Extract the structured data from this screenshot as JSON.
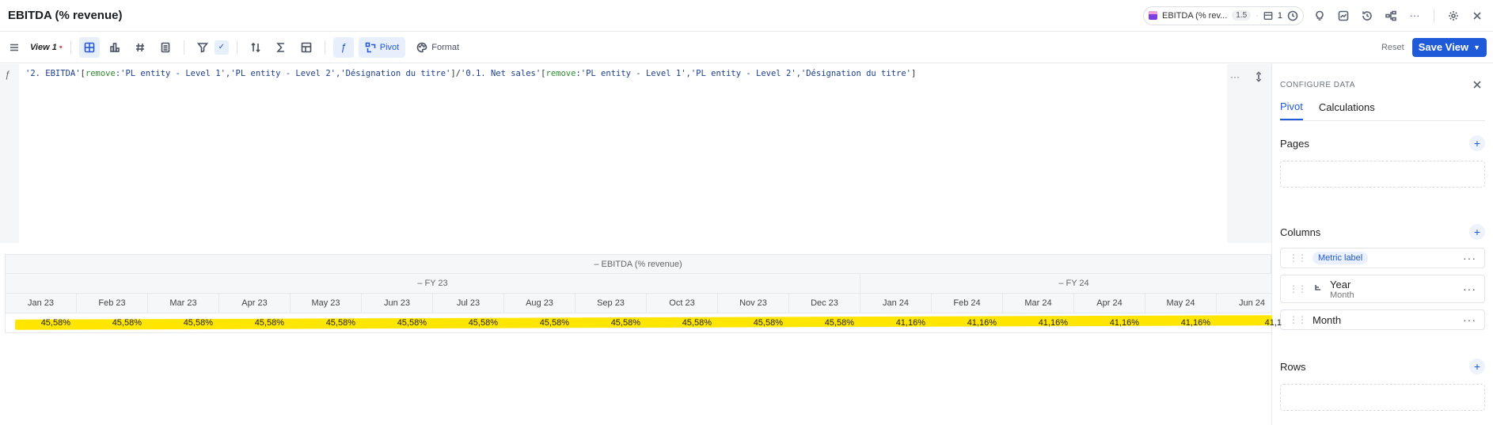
{
  "title": "EBITDA (% revenue)",
  "header_chip": {
    "label": "EBITDA (% rev...",
    "version": "1.5",
    "count": "1"
  },
  "toolbar": {
    "view_name": "View 1",
    "pivot_label": "Pivot",
    "format_label": "Format",
    "reset_label": "Reset",
    "save_label": "Save View"
  },
  "formula": {
    "parts": [
      {
        "t": "'2. EBITDA'",
        "c": "ref"
      },
      {
        "t": "[",
        "c": "op"
      },
      {
        "t": "remove",
        "c": "kw"
      },
      {
        "t": ":'PL entity - Level 1','PL entity - Level 2','Désignation du titre'",
        "c": "ref"
      },
      {
        "t": "]/",
        "c": "op"
      },
      {
        "t": "'0.1. Net sales'",
        "c": "ref"
      },
      {
        "t": "[",
        "c": "op"
      },
      {
        "t": "remove",
        "c": "kw"
      },
      {
        "t": ":'PL entity - Level 1','PL entity - Level 2','Désignation du titre'",
        "c": "ref"
      },
      {
        "t": "]",
        "c": "op"
      }
    ]
  },
  "table": {
    "metric_header": "– EBITDA (% revenue)",
    "groups": [
      {
        "label": "– FY 23",
        "span": 12
      },
      {
        "label": "– FY 24",
        "span": 6
      }
    ],
    "months": [
      "Jan 23",
      "Feb 23",
      "Mar 23",
      "Apr 23",
      "May 23",
      "Jun 23",
      "Jul 23",
      "Aug 23",
      "Sep 23",
      "Oct 23",
      "Nov 23",
      "Dec 23",
      "Jan 24",
      "Feb 24",
      "Mar 24",
      "Apr 24",
      "May 24",
      "Jun 24"
    ],
    "values": [
      "45,58%",
      "45,58%",
      "45,58%",
      "45,58%",
      "45,58%",
      "45,58%",
      "45,58%",
      "45,58%",
      "45,58%",
      "45,58%",
      "45,58%",
      "45,58%",
      "41,16%",
      "41,16%",
      "41,16%",
      "41,16%",
      "41,16%",
      "41,1"
    ],
    "highlight_color": "#ffe600"
  },
  "panel": {
    "caption": "CONFIGURE DATA",
    "tabs": [
      {
        "label": "Pivot",
        "active": true
      },
      {
        "label": "Calculations",
        "active": false
      }
    ],
    "pages_title": "Pages",
    "columns_title": "Columns",
    "column_fields": [
      {
        "label": "Metric label",
        "tag": true
      },
      {
        "label": "Year",
        "sub": "Month",
        "tag": false
      },
      {
        "label": "Month",
        "tag": false
      }
    ],
    "rows_title": "Rows"
  },
  "colors": {
    "accent": "#1f5ad9",
    "highlight": "#ffe600"
  }
}
